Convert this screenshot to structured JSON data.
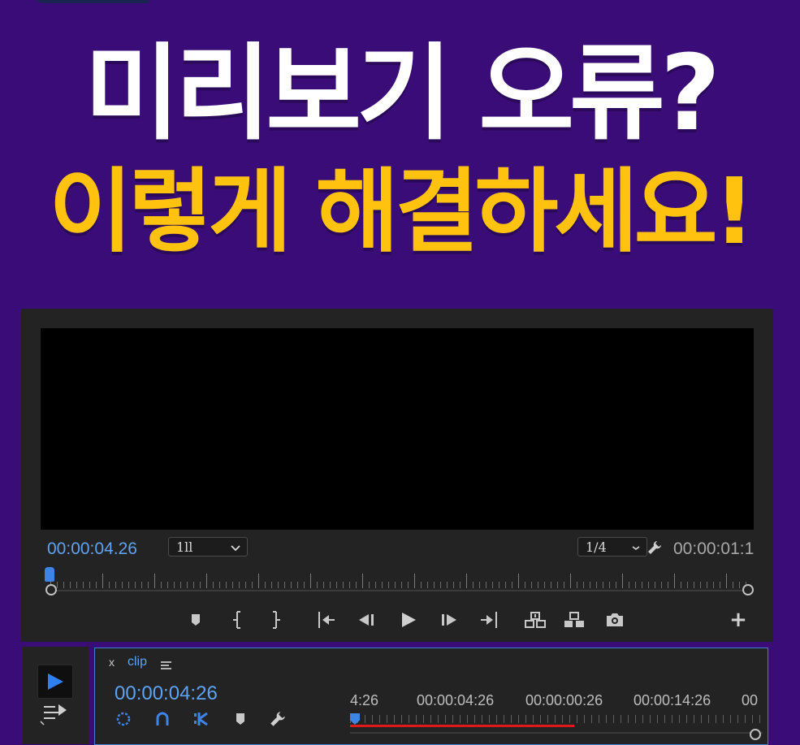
{
  "headline": {
    "line1": "미리보기 오류?",
    "line2": "이렇게 해결하세요!"
  },
  "colors": {
    "background": "#3a0c78",
    "headline1": "#ffffff",
    "headline2": "#ffc20f",
    "panel": "#232323",
    "timecode_blue": "#5ea2f2",
    "render_bar": "#e01a1a"
  },
  "program_monitor": {
    "current_timecode": "00:00:04.26",
    "zoom_value": "1ll",
    "resolution_value": "1/4",
    "duration_timecode": "00:00:01:1",
    "controls": [
      "mark-in-icon",
      "mark-in-bracket-icon",
      "mark-out-bracket-icon",
      "go-to-in-icon",
      "step-back-icon",
      "play-icon",
      "step-forward-icon",
      "go-to-out-icon",
      "lift-icon",
      "extract-icon",
      "export-frame-icon"
    ],
    "add_button": "+"
  },
  "timeline": {
    "close_label": "x",
    "sequence_name": "clip",
    "timecode": "00:00:04:26",
    "ruler_labels": [
      "4:26",
      "00:00:04:26",
      "00:00:00:26",
      "00:00:14:26",
      "00"
    ]
  }
}
